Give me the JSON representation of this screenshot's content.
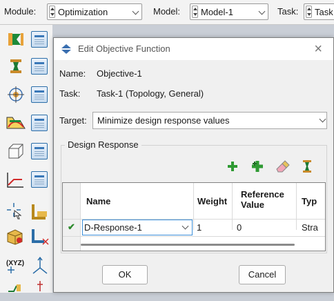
{
  "topbar": {
    "module_label": "Module:",
    "module_value": "Optimization",
    "model_label": "Model:",
    "model_value": "Model-1",
    "task_label": "Task:",
    "task_value": "Task"
  },
  "toolbox": {
    "icons": [
      "objective-function-tool-icon",
      "constraint-tool-icon",
      "design-response-tool-icon",
      "geometric-restriction-tool-icon",
      "stop-condition-tool-icon",
      "design-response-plot-tool-icon",
      "query-tool-icon",
      "partition-tool-icon",
      "datum-csys-tool-icon"
    ],
    "coord_label": "(XYZ)"
  },
  "dialog": {
    "title": "Edit Objective Function",
    "name_label": "Name:",
    "name_value": "Objective-1",
    "task_label": "Task:",
    "task_value": "Task-1 (Topology, General)",
    "target_label": "Target:",
    "target_value": "Minimize design response values",
    "group_label": "Design Response",
    "actions": [
      "add-icon",
      "add-multiple-icon",
      "eraser-icon",
      "filter-icon"
    ],
    "table": {
      "headers": [
        "Name",
        "Weight",
        "Reference Value",
        "Typ"
      ],
      "rows": [
        {
          "check": "✔",
          "name": "D-Response-1",
          "weight": "1",
          "reference": "0",
          "type": "Stra"
        }
      ]
    },
    "ok_label": "OK",
    "cancel_label": "Cancel"
  },
  "colors": {
    "accent": "#3c8fd9",
    "check_green": "#2e8b2e",
    "add_green": "#2f9a33"
  }
}
